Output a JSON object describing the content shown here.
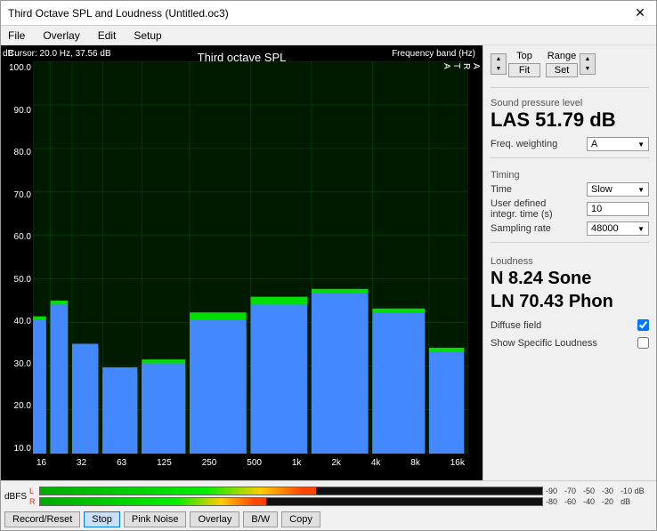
{
  "window": {
    "title": "Third Octave SPL and Loudness (Untitled.oc3)",
    "close_label": "✕"
  },
  "menu": {
    "items": [
      "File",
      "Overlay",
      "Edit",
      "Setup"
    ]
  },
  "chart": {
    "title": "Third octave SPL",
    "db_label": "dB",
    "arta_label": "A\nR\nT\nA",
    "y_labels": [
      "100.0",
      "90.0",
      "80.0",
      "70.0",
      "60.0",
      "50.0",
      "40.0",
      "30.0",
      "20.0",
      "10.0"
    ],
    "x_labels": [
      "16",
      "32",
      "63",
      "125",
      "250",
      "500",
      "1k",
      "2k",
      "4k",
      "8k",
      "16k"
    ],
    "cursor_text": "Cursor:  20.0 Hz, 37.56 dB",
    "freq_label": "Frequency band (Hz)"
  },
  "controls": {
    "top_label": "Top",
    "range_label": "Range",
    "fit_label": "Fit",
    "set_label": "Set"
  },
  "spl": {
    "section_label": "Sound pressure level",
    "value": "LAS 51.79 dB",
    "freq_weighting_label": "Freq. weighting",
    "freq_weighting_value": "A"
  },
  "timing": {
    "section_label": "Timing",
    "time_label": "Time",
    "time_value": "Slow",
    "user_defined_label": "User defined integr. time (s)",
    "user_defined_value": "10",
    "sampling_rate_label": "Sampling rate",
    "sampling_rate_value": "48000"
  },
  "loudness": {
    "section_label": "Loudness",
    "n_value": "N 8.24 Sone",
    "ln_value": "LN 70.43 Phon",
    "diffuse_field_label": "Diffuse field",
    "diffuse_field_checked": true,
    "show_specific_label": "Show Specific Loudness",
    "show_specific_checked": false
  },
  "meter": {
    "label": "dBFS",
    "l_label": "L",
    "r_label": "R",
    "ticks_L": [
      "-90",
      "-70",
      "-50",
      "-30",
      "-10 dB"
    ],
    "ticks_R": [
      "-80",
      "-60",
      "-40",
      "-20",
      "dB"
    ]
  },
  "buttons": {
    "record_reset": "Record/Reset",
    "stop": "Stop",
    "pink_noise": "Pink Noise",
    "overlay": "Overlay",
    "bw": "B/W",
    "copy": "Copy"
  }
}
